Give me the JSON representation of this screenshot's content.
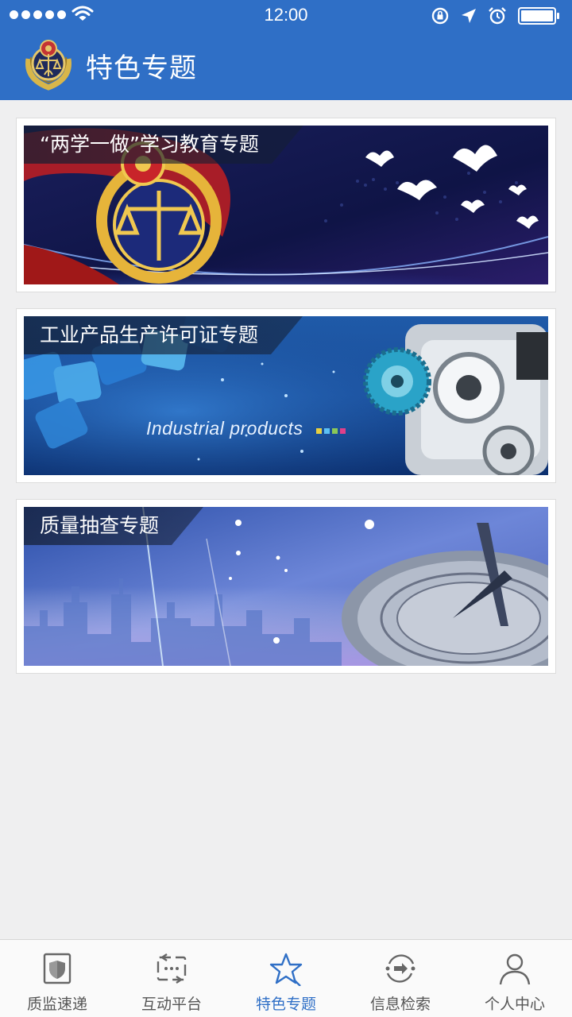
{
  "status": {
    "time": "12:00"
  },
  "nav": {
    "title": "特色专题"
  },
  "topics": [
    {
      "label": "“两学一做”学习教育专题"
    },
    {
      "label": "工业产品生产许可证专题",
      "banner_text": "Industrial  products"
    },
    {
      "label": "质量抽查专题"
    }
  ],
  "tabs": [
    {
      "label": "质监速递",
      "icon": "shield-icon"
    },
    {
      "label": "互动平台",
      "icon": "exchange-icon"
    },
    {
      "label": "特色专题",
      "icon": "star-icon"
    },
    {
      "label": "信息检索",
      "icon": "search-refresh-icon"
    },
    {
      "label": "个人中心",
      "icon": "person-icon"
    }
  ],
  "colors": {
    "primary": "#2f6fc6",
    "background": "#efeff0",
    "tab_active": "#2f6fc6",
    "tab_inactive": "#555555"
  }
}
